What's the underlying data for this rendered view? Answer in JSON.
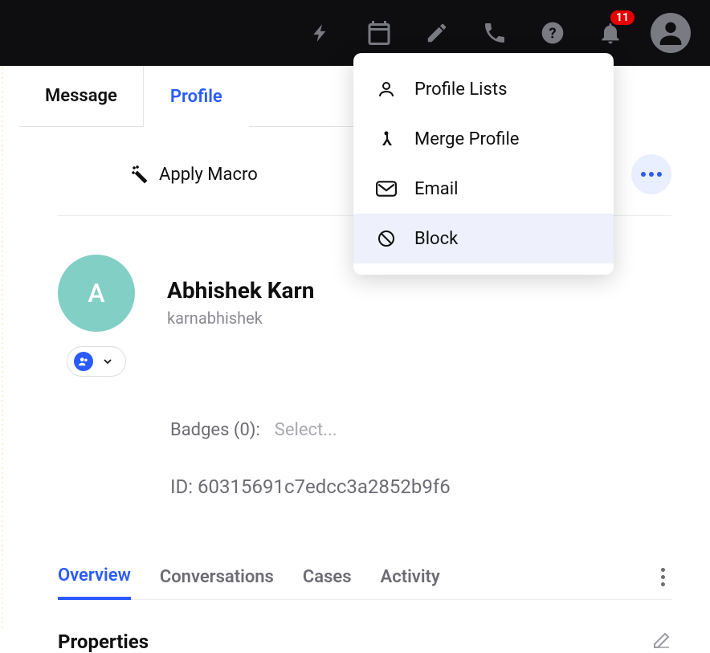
{
  "topbar": {
    "notification_count": "11"
  },
  "tabs": {
    "message": "Message",
    "profile": "Profile"
  },
  "macro": {
    "label": "Apply Macro"
  },
  "dropdown": {
    "profile_lists": "Profile Lists",
    "merge_profile": "Merge Profile",
    "email": "Email",
    "block": "Block"
  },
  "profile": {
    "initial": "A",
    "name": "Abhishek Karn",
    "username": "karnabhishek",
    "badges_label": "Badges (0):",
    "badges_placeholder": "Select...",
    "id_label": "ID: ",
    "id_value": "60315691c7edcc3a2852b9f6"
  },
  "subtabs": {
    "overview": "Overview",
    "conversations": "Conversations",
    "cases": "Cases",
    "activity": "Activity"
  },
  "properties": {
    "heading": "Properties"
  }
}
